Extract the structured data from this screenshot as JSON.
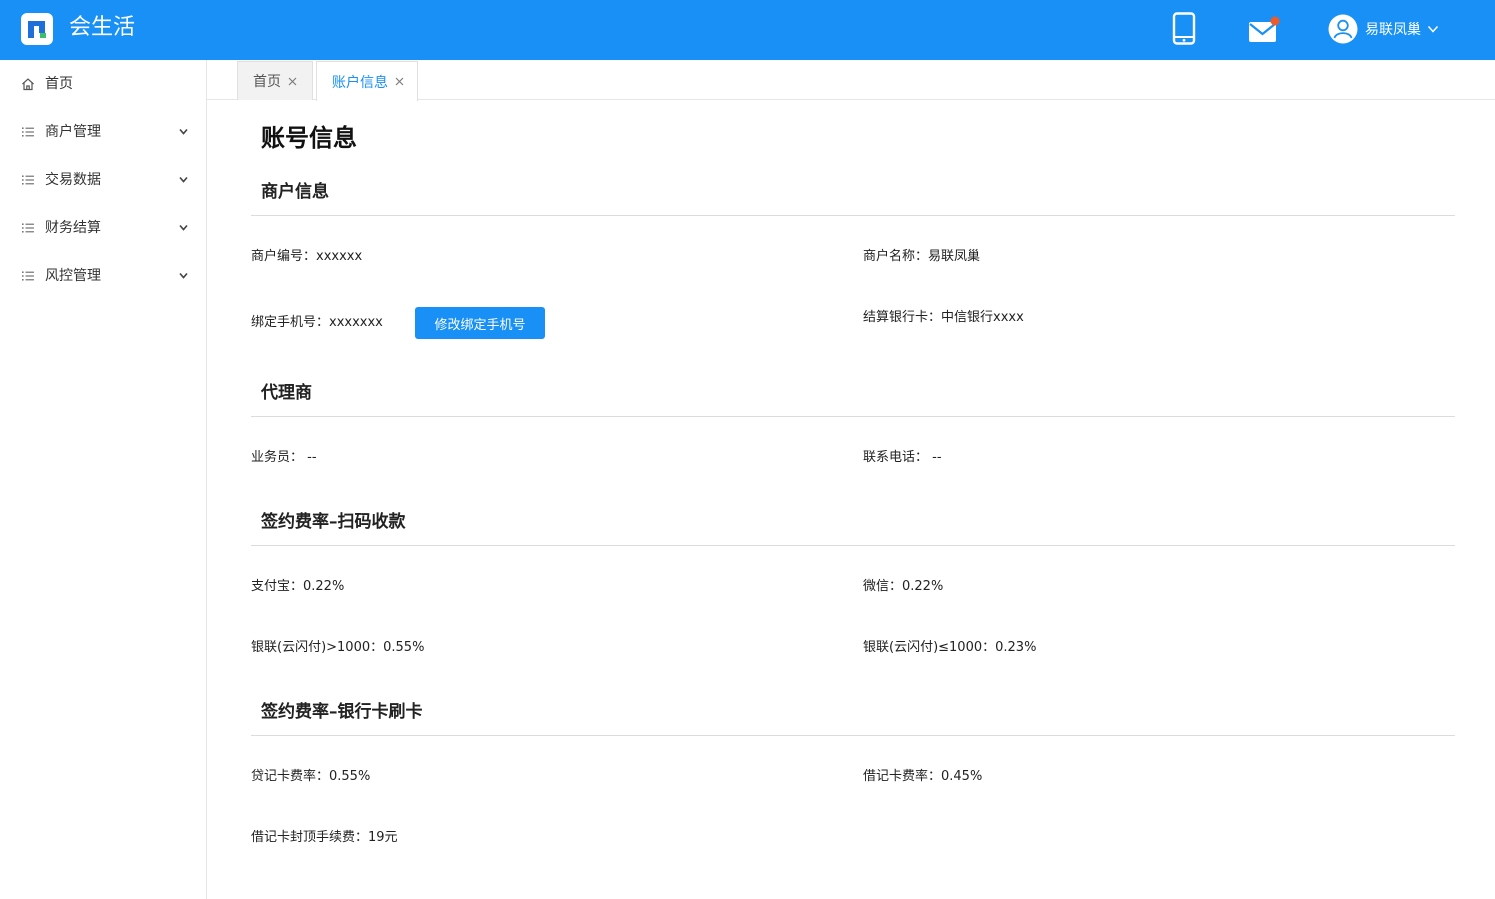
{
  "header": {
    "app_title": "会生活",
    "user_name": "易联凤巢",
    "icons": [
      "logo-icon",
      "phone-icon",
      "mail-icon",
      "avatar-icon",
      "chevron-down-icon"
    ],
    "colors": {
      "brand": "#1890f5",
      "notification_dot": "#f05a28"
    }
  },
  "sidebar": {
    "items": [
      {
        "label": "首页",
        "icon": "home-icon",
        "expandable": false
      },
      {
        "label": "商户管理",
        "icon": "list-icon",
        "expandable": true
      },
      {
        "label": "交易数据",
        "icon": "list-icon",
        "expandable": true
      },
      {
        "label": "财务结算",
        "icon": "list-icon",
        "expandable": true
      },
      {
        "label": "风控管理",
        "icon": "list-icon",
        "expandable": true
      }
    ]
  },
  "tabs": [
    {
      "label": "首页",
      "active": false
    },
    {
      "label": "账户信息",
      "active": true
    }
  ],
  "page": {
    "title": "账号信息",
    "merchant": {
      "title": "商户信息",
      "merchant_no": "商户编号：xxxxxx",
      "merchant_name": "商户名称：易联凤巢",
      "bound_phone": "绑定手机号：xxxxxxx",
      "change_phone_button": "修改绑定手机号",
      "settlement_card": "结算银行卡：中信银行xxxx"
    },
    "agent": {
      "title": "代理商",
      "salesperson": "业务员： --",
      "contact_phone": "联系电话： --"
    },
    "rate_scan": {
      "title": "签约费率–扫码收款",
      "alipay": "支付宝：0.22%",
      "wechat": "微信：0.22%",
      "unionpay_gt": "银联(云闪付)>1000：0.55%",
      "unionpay_le": "银联(云闪付)≤1000：0.23%"
    },
    "rate_card": {
      "title": "签约费率–银行卡刷卡",
      "credit_rate": "贷记卡费率：0.55%",
      "debit_rate": "借记卡费率：0.45%",
      "debit_cap_fee": "借记卡封顶手续费：19元"
    }
  }
}
